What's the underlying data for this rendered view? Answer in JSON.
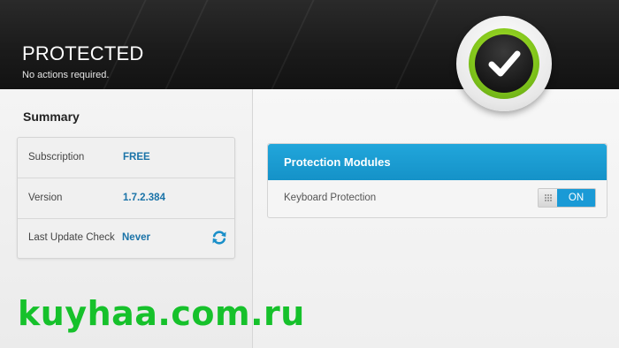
{
  "header": {
    "title": "PROTECTED",
    "subtitle": "No actions required."
  },
  "status_badge": {
    "icon": "checkmark-icon",
    "ring_color": "#8cd21f"
  },
  "summary": {
    "heading": "Summary",
    "rows": [
      {
        "label": "Subscription",
        "value": "FREE"
      },
      {
        "label": "Version",
        "value": "1.7.2.384"
      },
      {
        "label": "Last Update Check",
        "value": "Never",
        "icon": "refresh-icon"
      }
    ]
  },
  "modules": {
    "title": "Protection Modules",
    "items": [
      {
        "label": "Keyboard Protection",
        "toggle": "ON"
      }
    ]
  },
  "watermark": "kuyhaa.com.ru",
  "colors": {
    "accent": "#1a9ad6",
    "value_text": "#1a73a8",
    "watermark": "#16c12b"
  }
}
